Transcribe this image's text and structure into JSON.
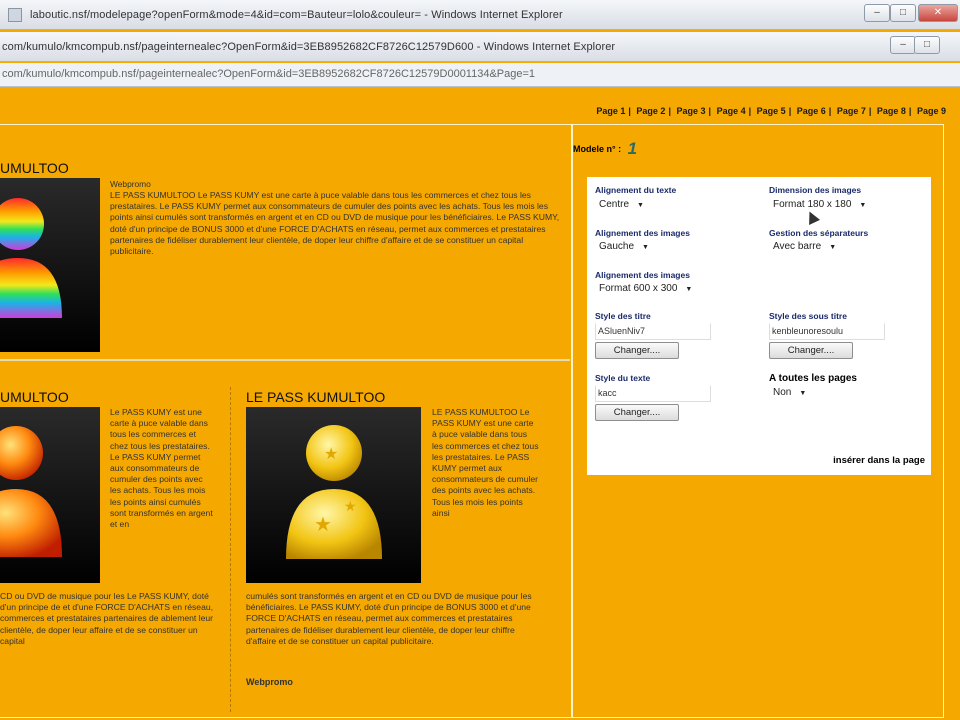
{
  "windows": {
    "bar1_title": "laboutic.nsf/modelepage?openForm&mode=4&id=com=Bauteur=lolo&couleur= - Windows Internet Explorer",
    "bar2_title": "com/kumulo/kmcompub.nsf/pageinternealec?OpenForm&id=3EB8952682CF8726C12579D600 - Windows Internet Explorer",
    "address": "com/kumulo/kmcompub.nsf/pageinternealec?OpenForm&id=3EB8952682CF8726C12579D0001134&Page=1"
  },
  "pagenav": [
    "Page 1",
    "Page 2",
    "Page 3",
    "Page 4",
    "Page 5",
    "Page 6",
    "Page 7",
    "Page 8",
    "Page 9"
  ],
  "pagenav_sep": "|",
  "content": {
    "block1": {
      "heading": "UMULTOO",
      "subheading": "Webpromo",
      "text": "LE PASS KUMULTOO Le PASS KUMY est une carte à puce valable dans tous les commerces et chez tous les prestataires. Le PASS KUMY permet aux consommateurs de cumuler des points avec les achats. Tous les mois les points ainsi cumulés sont transformés en argent et en CD ou DVD de musique pour les bénéficiaires. Le PASS KUMY, doté d'un principe de BONUS 3000 et d'une FORCE D'ACHATS en réseau, permet aux commerces et prestataires partenaires de fidéliser durablement leur clientèle, de doper leur chiffre d'affaire et de se constituer un capital publicitaire."
    },
    "block2": {
      "heading": "UMULTOO",
      "text_side": "Le PASS KUMY est une carte à puce valable dans tous les commerces et chez tous les prestataires. Le PASS KUMY permet aux consommateurs de cumuler des points avec les achats. Tous les mois les points ainsi cumulés sont transformés en argent et en",
      "text_bottom": "CD ou DVD de musique pour les Le PASS KUMY, doté d'un principe de et d'une FORCE D'ACHATS en réseau, commerces et prestataires partenaires de ablement leur clientèle, de doper leur affaire et de se constituer un capital"
    },
    "block3": {
      "heading": "LE PASS KUMULTOO",
      "text_side": "LE PASS KUMULTOO Le PASS KUMY est une carte à puce valable dans tous les commerces et chez tous les prestataires. Le PASS KUMY permet aux consommateurs de cumuler des points avec les achats. Tous les mois les points ainsi",
      "text_bottom": "cumulés sont transformés en argent et en CD ou DVD de musique pour les bénéficiaires. Le PASS KUMY, doté d'un principe de BONUS 3000 et d'une FORCE D'ACHATS en réseau, permet aux commerces et prestataires partenaires de fidéliser durablement leur clientèle, de doper leur chiffre d'affaire et de se constituer un capital publicitaire.",
      "footer": "Webpromo"
    }
  },
  "right": {
    "modele_label": "Modele n° :",
    "modele_num": "1",
    "form": {
      "align_text_label": "Alignement du texte",
      "align_text_value": "Centre",
      "img_dim_label": "Dimension des images",
      "img_dim_value": "Format 180 x 180",
      "align_img_label": "Alignement des images",
      "align_img_value": "Gauche",
      "sep_label": "Gestion des séparateurs",
      "sep_value": "Avec barre",
      "align_img2_label": "Alignement des images",
      "align_img2_value": "Format 600 x 300",
      "title_style_label": "Style des titre",
      "title_style_value": "ASluenNiv7",
      "subtitle_style_label": "Style des sous titre",
      "subtitle_style_value": "kenbleunoresoulu",
      "change_label": "Changer....",
      "text_style_label": "Style du texte",
      "text_style_value": "kacc",
      "all_pages_label": "A toutes les pages",
      "all_pages_value": "Non",
      "insert_label": "insérer dans la page"
    }
  },
  "colors": {
    "page_bg": "#f5a800",
    "form_bg": "#ffffff",
    "label_blue": "#1a2a6a"
  }
}
